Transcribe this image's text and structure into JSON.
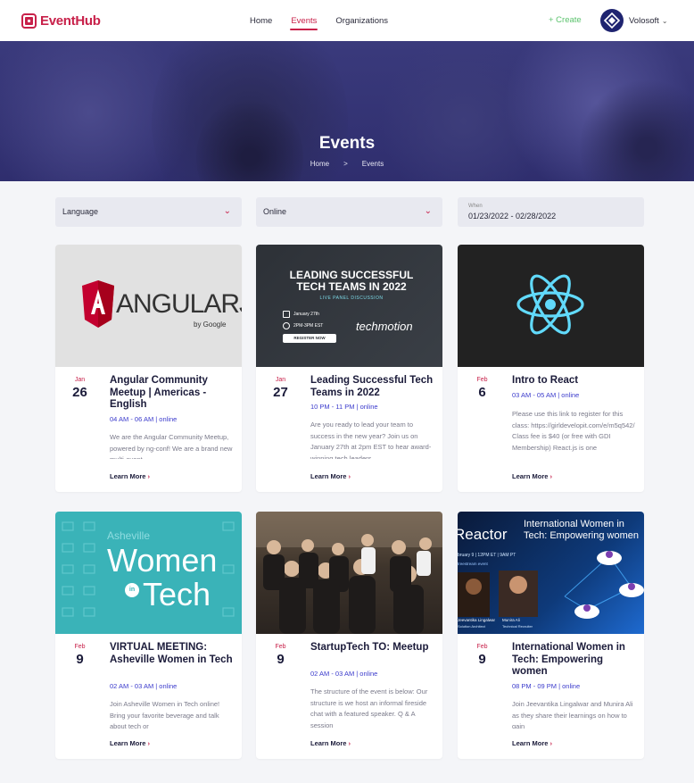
{
  "brand": {
    "logo_text": "EventHub"
  },
  "nav": {
    "items": [
      {
        "label": "Home",
        "active": false
      },
      {
        "label": "Events",
        "active": true
      },
      {
        "label": "Organizations",
        "active": false
      }
    ],
    "create_label": "+ Create",
    "user_name": "Volosoft"
  },
  "hero": {
    "title": "Events",
    "breadcrumb": [
      "Home",
      ">",
      "Events"
    ]
  },
  "filters": {
    "language": "Language",
    "type": "Online",
    "when_label": "When",
    "when_value": "01/23/2022 - 02/28/2022"
  },
  "events": [
    {
      "month": "Jan",
      "day": "26",
      "title": "Angular Community Meetup | Americas - English",
      "time": "04 AM - 06 AM | online",
      "desc": "We are the Angular Community Meetup, powered by ng-conf! We are a brand new multi-event",
      "more": "Learn More",
      "image": {
        "kind": "angularjs",
        "logo_text": "ANGULARJS",
        "by_text": "by Google"
      }
    },
    {
      "month": "Jan",
      "day": "27",
      "title": "Leading Successful Tech Teams in 2022",
      "time": "10 PM - 11 PM | online",
      "desc": "Are you ready to lead your team to success in the new year? Join us on January 27th at 2pm EST to hear award-winning tech leaders",
      "more": "Learn More",
      "image": {
        "kind": "techmotion",
        "headline": "LEADING SUCCESSFUL TECH TEAMS IN 2022",
        "sub": "LIVE PANEL DISCUSSION",
        "date": "January 27th",
        "hours": "2PM-3PM EST",
        "button": "REGISTER NOW",
        "brand": "techmotion"
      }
    },
    {
      "month": "Feb",
      "day": "6",
      "title": "Intro to React",
      "time": "03 AM - 05 AM | online",
      "desc": "Please use this link to register for this class: https://girldevelopit.com/e/m5q542/ Class fee is $40 (or free with GDI Membership) React.js is one",
      "more": "Learn More",
      "image": {
        "kind": "react"
      }
    },
    {
      "month": "Feb",
      "day": "9",
      "title": "VIRTUAL MEETING: Asheville Women in Tech",
      "time": "02 AM - 03 AM | online",
      "desc": "Join Asheville Women in Tech online! Bring your favorite beverage and talk about tech or",
      "more": "Learn More",
      "image": {
        "kind": "women",
        "line1": "Asheville",
        "line2": "Women",
        "line3": "in",
        "line4": "Tech"
      }
    },
    {
      "month": "Feb",
      "day": "9",
      "title": "StartupTech TO: Meetup",
      "time": "02 AM - 03 AM | online",
      "desc": "The structure of the event is below: Our structure is we host an informal fireside chat with a featured speaker. Q & A session",
      "more": "Learn More",
      "image": {
        "kind": "photo"
      }
    },
    {
      "month": "Feb",
      "day": "9",
      "title": "International Women in Tech: Empowering women",
      "time": "08 PM - 09 PM | online",
      "desc": "Join Jeevantika Lingalwar and Munira Ali as they share their learnings on how to gain",
      "more": "Learn More",
      "image": {
        "kind": "reactor",
        "brand": "Reactor",
        "headline": "International Women in Tech: Empowering women",
        "meta": "bruary 9 | 12PM ET | 9AM PT",
        "stream": "treestream event",
        "speaker1": "Jeevantika Lingalwar",
        "speaker1_role": "Solution Architect",
        "speaker2": "Munira Ali",
        "speaker2_role": "Technical Recruiter"
      }
    }
  ]
}
